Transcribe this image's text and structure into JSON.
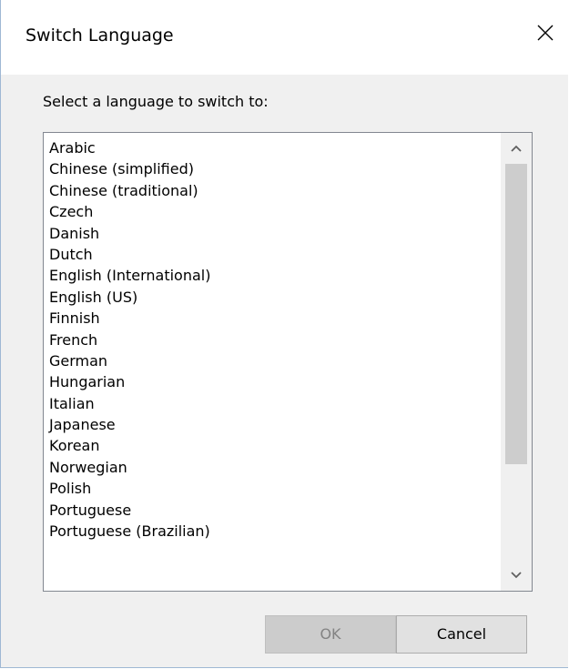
{
  "window": {
    "title": "Switch Language",
    "close_icon": "close-icon"
  },
  "instruction": "Select a language to switch to:",
  "languages": [
    "Arabic",
    "Chinese (simplified)",
    "Chinese (traditional)",
    "Czech",
    "Danish",
    "Dutch",
    "English (International)",
    "English (US)",
    "Finnish",
    "French",
    "German",
    "Hungarian",
    "Italian",
    "Japanese",
    "Korean",
    "Norwegian",
    "Polish",
    "Portuguese",
    "Portuguese (Brazilian)"
  ],
  "scrollbar": {
    "up_icon": "chevron-up-icon",
    "down_icon": "chevron-down-icon"
  },
  "buttons": {
    "ok_label": "OK",
    "ok_enabled": false,
    "cancel_label": "Cancel"
  },
  "colors": {
    "dialog_bg": "#f0f0f0",
    "title_bg": "#ffffff",
    "list_border": "#828790",
    "thumb": "#cdcdcd",
    "ok_disabled_text": "#838383"
  }
}
